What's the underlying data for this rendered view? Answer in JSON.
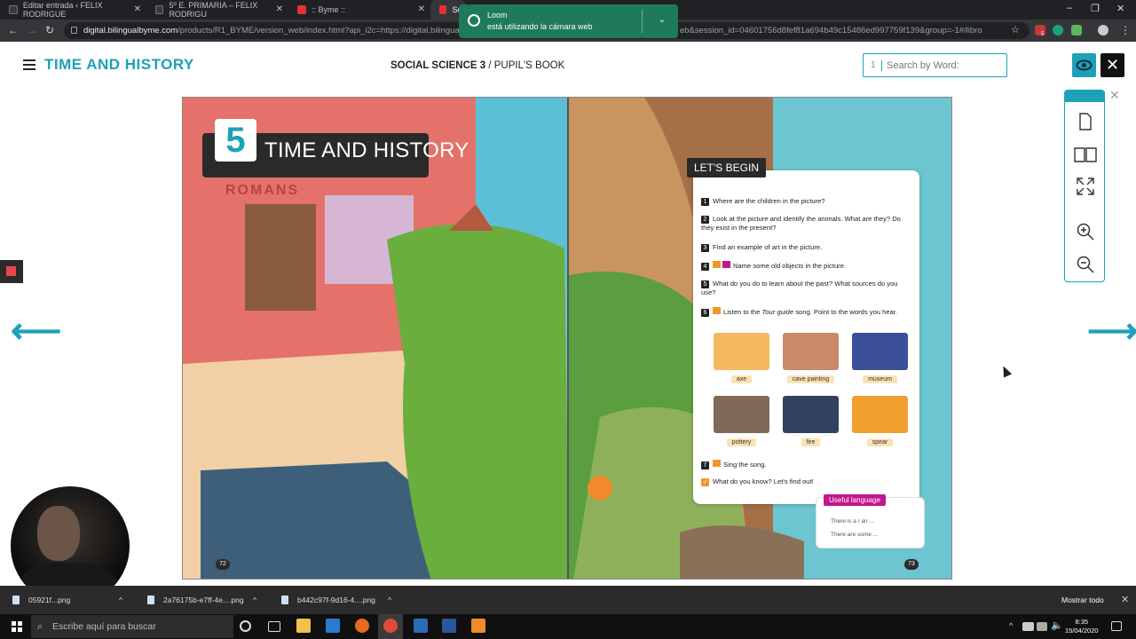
{
  "browser": {
    "tabs": [
      {
        "label": "Editar entrada ‹ FELIX RODRIGUE",
        "active": false
      },
      {
        "label": "5º E. PRIMARIA – FELIX RODRIGU",
        "active": false
      },
      {
        "label": ":: Byme ::",
        "active": false
      },
      {
        "label": "Soc",
        "active": true
      }
    ],
    "url_host": "digital.bilingualbyme.com",
    "url_path_left": "/products/R1_BYME/version_web/index.html?api_i2c=https://digital.bilingual",
    "url_path_right": "eb&session_id=04601756d8fef81a694b49c15486ed997759f139&group=-1#/libro",
    "extension_badge": "5"
  },
  "loom_notification": {
    "title": "Loom",
    "message": "está utilizando la cámara web"
  },
  "app": {
    "title": "TIME AND HISTORY",
    "book_title_bold": "SOCIAL SCIENCE 3",
    "book_title_rest": " / PUPIL'S BOOK",
    "search": {
      "page": "1",
      "placeholder": "Search by Word:"
    }
  },
  "book": {
    "chapter_number": "5",
    "chapter_title": "TIME AND HISTORY",
    "sign_text": "ROMANS",
    "lets_begin": "LET'S BEGIN",
    "questions": [
      {
        "n": "1",
        "text": "Where are the children in the picture?"
      },
      {
        "n": "2",
        "text": "Look at the picture and identify the animals. What are they? Do they exist in the present?"
      },
      {
        "n": "3",
        "text": "Find an example of art in the picture."
      },
      {
        "n": "4",
        "text": "Name some old objects in the picture."
      },
      {
        "n": "5",
        "text": "What do you do to learn about the past? What sources do you use?"
      },
      {
        "n": "6",
        "text_before": "Listen to the ",
        "text_em": "Tour guide",
        "text_after": " song. Point to the words you hear."
      }
    ],
    "thumbnails": [
      "axe",
      "cave painting",
      "museum",
      "pottery",
      "fire",
      "spear"
    ],
    "q7": {
      "n": "7",
      "text": "Sing the song."
    },
    "q_check": {
      "text": "What do you know? Let's find out!"
    },
    "useful_language": {
      "title": "Useful language",
      "lines": [
        "There is a / an ...",
        "There are some ..."
      ]
    },
    "page_left": "72",
    "page_right": "73"
  },
  "downloads": {
    "items": [
      "05921f...png",
      "2a76175b-e7ff-4e....png",
      "b442c97f-9d16-4....png"
    ],
    "show_all": "Mostrar todo"
  },
  "taskbar": {
    "search_placeholder": "Escribe aquí para buscar",
    "time": "8:35",
    "date": "15/04/2020"
  },
  "colors": {
    "accent": "#1da1b9",
    "browser_dark": "#202124",
    "loom_green": "#1f7a5a",
    "magenta": "#c2168a"
  }
}
